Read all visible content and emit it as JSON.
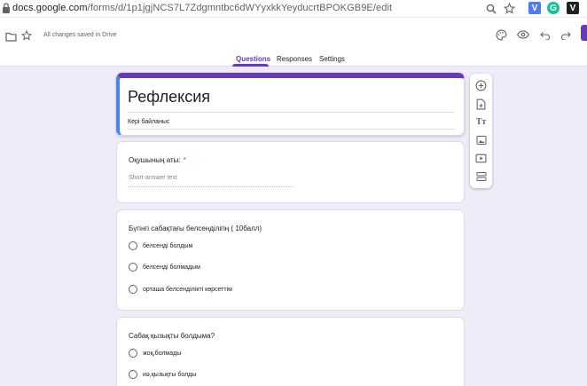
{
  "browser": {
    "url_host": "docs.google.com",
    "url_path": "/forms/d/1p1jgjNCS7L7Zdgmntbc6dWYyxkkYeyducrtBPOKGB9E/edit",
    "extensions": [
      {
        "name": "v-extension",
        "letter": "V",
        "color": "#4a7df0"
      },
      {
        "name": "grammarly-extension",
        "letter": "G",
        "color": "#15c39a"
      },
      {
        "name": "v-dark-extension",
        "letter": "V",
        "color": "#202124"
      }
    ]
  },
  "header": {
    "saved_status": "All changes saved in Drive",
    "accent_color": "#673ab7"
  },
  "tabs": [
    {
      "label": "Questions",
      "active": true
    },
    {
      "label": "Responses",
      "active": false
    },
    {
      "label": "Settings",
      "active": false
    }
  ],
  "form": {
    "title": "Рефлексия",
    "description": "Кері байланыс"
  },
  "questions": [
    {
      "title": "Оқушының аты:",
      "required": "*",
      "type": "short-answer",
      "placeholder": "Short-answer text"
    },
    {
      "title": "Бүгінгі сабақтағы белсенділігің ( 10балл)",
      "type": "multiple-choice",
      "options": [
        "белсенді болдым",
        "белсенді болмадым",
        "орташа белсенділікті көрсеттім"
      ]
    },
    {
      "title": "Сабақ қызықты болдыма?",
      "type": "multiple-choice",
      "options": [
        "жоқ,болмады",
        "иә,қызықты болды"
      ]
    }
  ],
  "toolbar": [
    "add-question-icon",
    "import-questions-icon",
    "add-title-icon",
    "add-image-icon",
    "add-video-icon",
    "add-section-icon"
  ]
}
